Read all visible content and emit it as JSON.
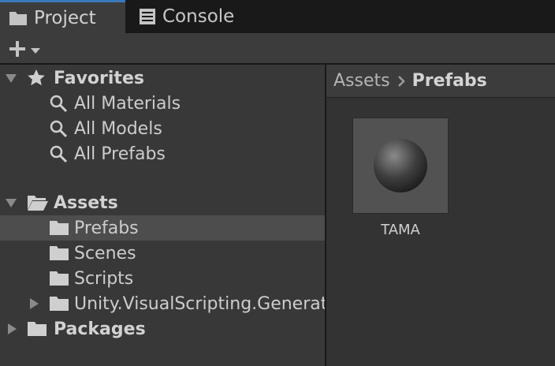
{
  "tabs": [
    {
      "label": "Project",
      "icon": "folder-icon",
      "active": true
    },
    {
      "label": "Console",
      "icon": "console-icon",
      "active": false
    }
  ],
  "toolbar": {
    "add_icon": "plus-icon"
  },
  "favorites": {
    "label": "Favorites",
    "items": [
      {
        "label": "All Materials"
      },
      {
        "label": "All Models"
      },
      {
        "label": "All Prefabs"
      }
    ]
  },
  "assets": {
    "label": "Assets",
    "items": [
      {
        "label": "Prefabs",
        "selected": true
      },
      {
        "label": "Scenes"
      },
      {
        "label": "Scripts"
      },
      {
        "label": "Unity.VisualScripting.Generated"
      }
    ]
  },
  "packages": {
    "label": "Packages"
  },
  "breadcrumb": {
    "root": "Assets",
    "current": "Prefabs"
  },
  "grid": {
    "items": [
      {
        "label": "TAMA",
        "type": "sphere-prefab"
      }
    ]
  },
  "colors": {
    "accent": "#3a79bb",
    "selected_row": "#4d4d4d"
  }
}
